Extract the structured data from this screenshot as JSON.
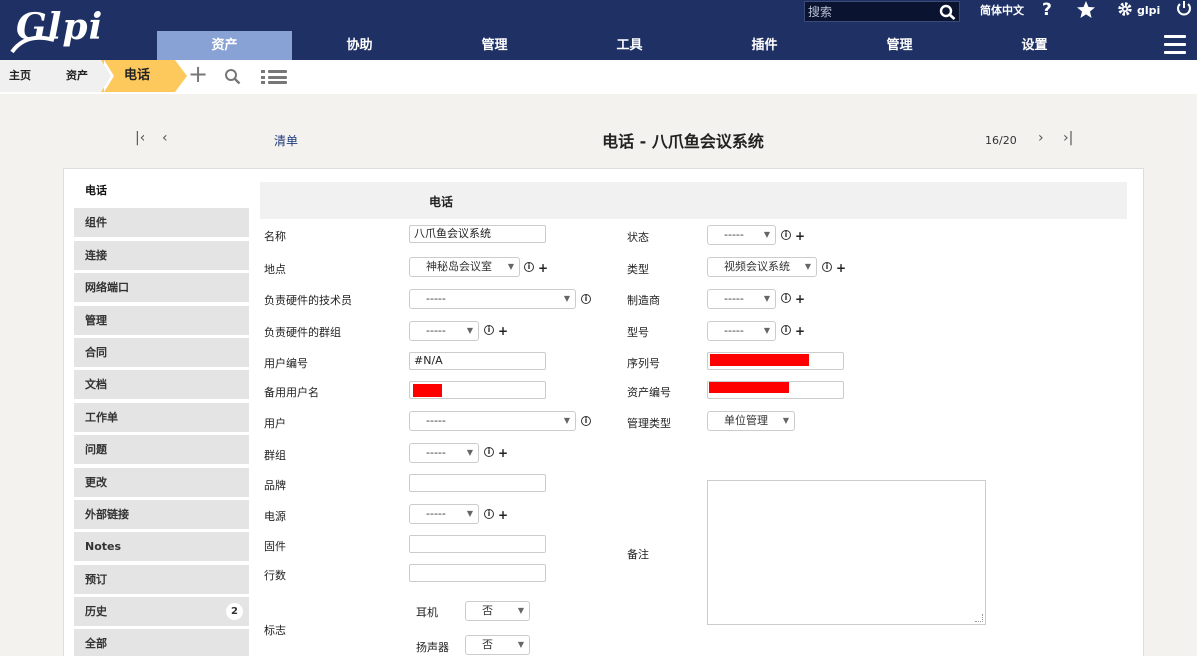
{
  "header": {
    "logo": "Glpi",
    "search_placeholder": "搜索",
    "language": "简体中文",
    "user": "glpi"
  },
  "menu": [
    {
      "label": "资产",
      "active": true
    },
    {
      "label": "协助",
      "active": false
    },
    {
      "label": "管理",
      "active": false
    },
    {
      "label": "工具",
      "active": false
    },
    {
      "label": "插件",
      "active": false
    },
    {
      "label": "管理",
      "active": false
    },
    {
      "label": "设置",
      "active": false
    }
  ],
  "breadcrumb": {
    "home": "主页",
    "assets": "资产",
    "current": "电话"
  },
  "nav": {
    "list": "清单",
    "title": "电话 - 八爪鱼会议系统",
    "pager": "16/20"
  },
  "tabs": [
    {
      "label": "电话",
      "active": true
    },
    {
      "label": "组件"
    },
    {
      "label": "连接"
    },
    {
      "label": "网络端口"
    },
    {
      "label": "管理"
    },
    {
      "label": "合同"
    },
    {
      "label": "文档"
    },
    {
      "label": "工作单"
    },
    {
      "label": "问题"
    },
    {
      "label": "更改"
    },
    {
      "label": "外部链接"
    },
    {
      "label": "Notes"
    },
    {
      "label": "预订"
    },
    {
      "label": "历史",
      "badge": "2"
    },
    {
      "label": "全部"
    }
  ],
  "form": {
    "header": "电话",
    "left": {
      "name_label": "名称",
      "name_value": "八爪鱼会议系统",
      "location_label": "地点",
      "location_value": "神秘岛会议室",
      "tech_label": "负责硬件的技术员",
      "tech_value": "-----",
      "techgroup_label": "负责硬件的群组",
      "techgroup_value": "-----",
      "usernum_label": "用户编号",
      "usernum_value": "#N/A",
      "altuser_label": "备用用户名",
      "user_label": "用户",
      "user_value": "-----",
      "group_label": "群组",
      "group_value": "-----",
      "brand_label": "品牌",
      "power_label": "电源",
      "power_value": "-----",
      "firmware_label": "固件",
      "lines_label": "行数",
      "flags_label": "标志",
      "headset_label": "耳机",
      "headset_value": "否",
      "speaker_label": "扬声器",
      "speaker_value": "否"
    },
    "right": {
      "status_label": "状态",
      "status_value": "-----",
      "type_label": "类型",
      "type_value": "视频会议系统",
      "manufacturer_label": "制造商",
      "manufacturer_value": "-----",
      "model_label": "型号",
      "model_value": "-----",
      "serial_label": "序列号",
      "inventory_label": "资产编号",
      "mgmt_label": "管理类型",
      "mgmt_value": "单位管理",
      "comment_label": "备注"
    }
  }
}
